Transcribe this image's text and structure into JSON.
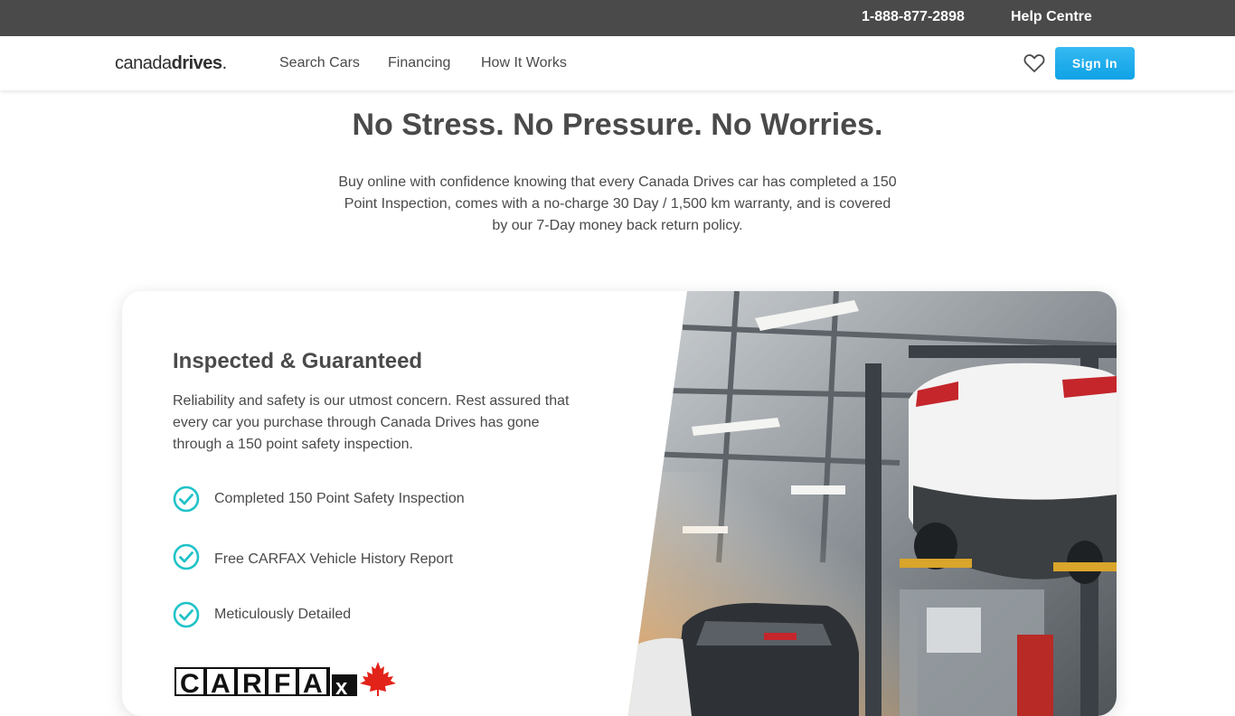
{
  "topbar": {
    "phone": "1-888-877-2898",
    "help": "Help Centre"
  },
  "nav": {
    "logo_canada": "canada",
    "logo_drives": "drives",
    "links": [
      "Search Cars",
      "Financing",
      "How It Works"
    ],
    "signin_label": "Sign In",
    "heart_icon": "heart-icon"
  },
  "hero": {
    "headline": "No Stress. No Pressure. No Worries.",
    "subtext": "Buy online with confidence knowing that every Canada Drives car has completed a 150 Point Inspection, comes with a no-charge 30 Day / 1,500 km warranty, and is covered by our 7-Day money back return policy."
  },
  "card": {
    "title": "Inspected & Guaranteed",
    "description": "Reliability and safety is our utmost concern. Rest assured that every car you purchase through Canada Drives has gone through a 150 point safety inspection.",
    "features": [
      "Completed 150 Point Safety Inspection",
      "Free CARFAX Vehicle History Report",
      "Meticulously Detailed"
    ],
    "check_icon": "check-circle-icon",
    "logo_text": "CARFAX"
  },
  "colors": {
    "topbar_bg": "#4a4a4a",
    "accent_blue": "#1aa8ea",
    "check_teal": "#1fc3c8",
    "text": "#4a4a4a",
    "carfax_red": "#e2231a"
  }
}
